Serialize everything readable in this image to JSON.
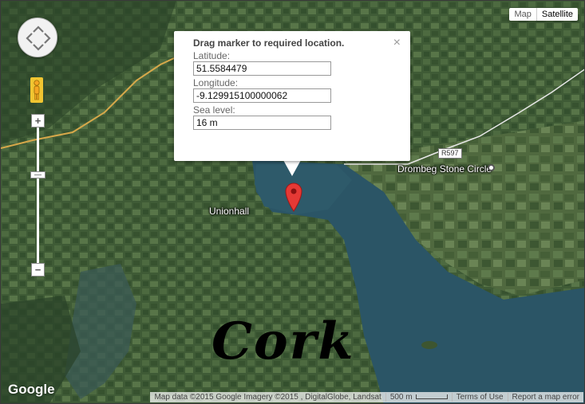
{
  "map": {
    "type_toggle": {
      "map_label": "Map",
      "satellite_label": "Satellite",
      "active": "Satellite"
    },
    "controls": {
      "zoom_in": "+",
      "zoom_out": "−"
    },
    "places": {
      "unionhall": "Unionhall",
      "drombeg": "Drombeg Stone Circle",
      "road": "R597"
    },
    "overlay_text": "Cork",
    "logo": "Google",
    "attribution": {
      "data": "Map data ©2015 Google Imagery ©2015 , DigitalGlobe, Landsat",
      "scale": "500 m",
      "terms": "Terms of Use",
      "report": "Report a map error"
    }
  },
  "info_window": {
    "title": "Drag marker to required location.",
    "close": "×",
    "latitude_label": "Latitude:",
    "latitude_value": "51.5584479",
    "longitude_label": "Longitude:",
    "longitude_value": "-9.129915100000062",
    "sea_level_label": "Sea level:",
    "sea_level_value": "16 m"
  },
  "colors": {
    "land_dark": "#2f4a2e",
    "land_mid": "#4e6b3f",
    "water": "#2b5566",
    "marker": "#e53935"
  }
}
